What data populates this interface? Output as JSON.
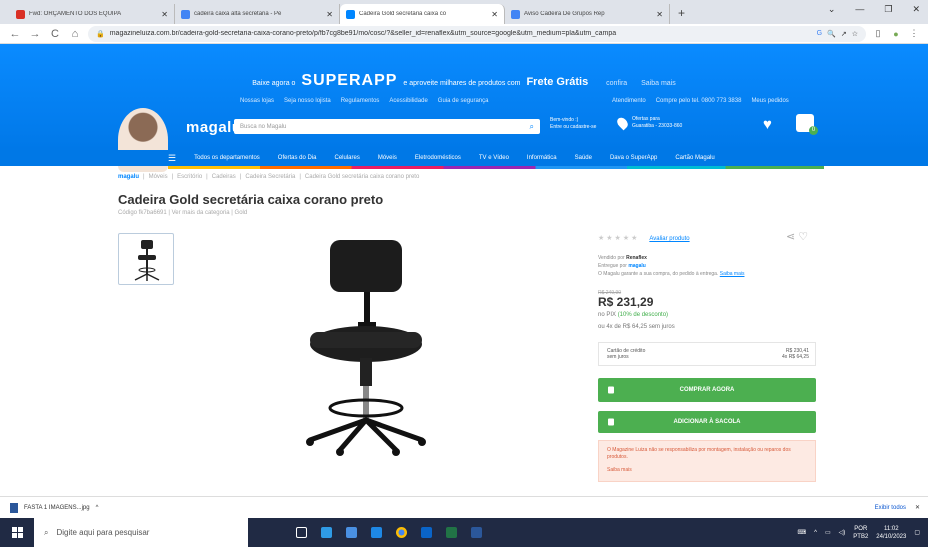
{
  "browser": {
    "tabs": [
      {
        "title": "Fwd: ORÇAMENTO DOS EQUIPA",
        "icon_color": "#d93025",
        "active": false
      },
      {
        "title": "cadeira caixa alta secretaria - Pe",
        "icon_color": "#4285f4",
        "active": false
      },
      {
        "title": "Cadeira Gold secretária caixa co",
        "icon_color": "#0086ff",
        "active": true
      },
      {
        "title": "Aviso Cadeira De Grupos Rep",
        "icon_color": "#4285f4",
        "active": false
      }
    ],
    "new_tab": "+",
    "window_controls": [
      "⌄",
      "—",
      "❐",
      "✕"
    ],
    "url": "magazineluiza.com.br/cadeira-gold-secretaria-caixa-corano-preto/p/fb7cg8be91/mo/cosc/?&seller_id=renaflex&utm_source=google&utm_medium=pla&utm_campa",
    "nav": {
      "back": "←",
      "forward": "→",
      "reload": "C",
      "home": "⌂"
    }
  },
  "site": {
    "promo": {
      "prefix": "Baixe agora o",
      "superapp": "SUPERAPP",
      "middle": "e aproveite milhares de produtos com",
      "frete": "Frete Grátis",
      "suffix": "confira",
      "extra": "Saiba mais"
    },
    "links_left": [
      "Nossas lojas",
      "Seja nosso lojista",
      "Regulamentos",
      "Acessibilidade",
      "Guia de segurança"
    ],
    "links_right": [
      "Atendimento",
      "Compre pelo tel. 0800 773 3838",
      "Meus pedidos"
    ],
    "logo": "magalu",
    "search_placeholder": "Busca no Magalu",
    "login_line1": "Bem-vindo :)",
    "login_line2": "Entre ou cadastre-se",
    "store_line1": "Ofertas para",
    "store_line2": "Guaratiba - 23033-860",
    "cart_count": "0",
    "categories": [
      "Todos os departamentos",
      "Ofertas do Dia",
      "Celulares",
      "Móveis",
      "Eletrodomésticos",
      "TV e Vídeo",
      "Informática",
      "Saúde",
      "Dava o SuperApp",
      "Cartão Magalu"
    ]
  },
  "product": {
    "breadcrumb_logo": "magalu",
    "breadcrumb": [
      "Móveis",
      "Escritório",
      "Cadeiras",
      "Cadeira Secretária",
      "Cadeira Gold secretária caixa corano preto"
    ],
    "title": "Cadeira Gold secretária caixa corano preto",
    "subtitle": "Código fk7ba6691 | Ver mais da categoria | Gold",
    "rating_label": "Avaliar produto",
    "stars": "★★★★★",
    "sold_by": "Vendido por",
    "seller": "Renaflex",
    "delivered_by": "Entregue por",
    "delivered_logo": "magalu",
    "guarantee": "O Magalu garante a sua compra, do pedido à entrega.",
    "guarantee_link": "Saiba mais",
    "old_price": "R$ 249,90",
    "price": "R$ 231,29",
    "pix_prefix": "no PIX",
    "pix_discount": "(10% de desconto)",
    "installments": "ou 4x de R$ 64,25 sem juros",
    "card_label": "Cartão de crédito",
    "card_sub": "sem juros",
    "card_price": "R$ 230,41",
    "card_sub2": "4x R$ 64,25",
    "buy_now": "COMPRAR AGORA",
    "add_to_bag": "ADICIONAR À SACOLA",
    "notice": "O Magazine Luiza não se responsabiliza por montagem, instalação ou reparos dos produtos.",
    "notice_link": "Saiba mais"
  },
  "download": {
    "file": "FASTA 1 IMAGENS...jpg",
    "chevron": "^",
    "show_all": "Exibir todos",
    "close": "✕"
  },
  "taskbar": {
    "search": "Digite aqui para pesquisar",
    "lang": "POR",
    "lang2": "PTB2",
    "time": "11:02",
    "date": "24/10/2023"
  }
}
